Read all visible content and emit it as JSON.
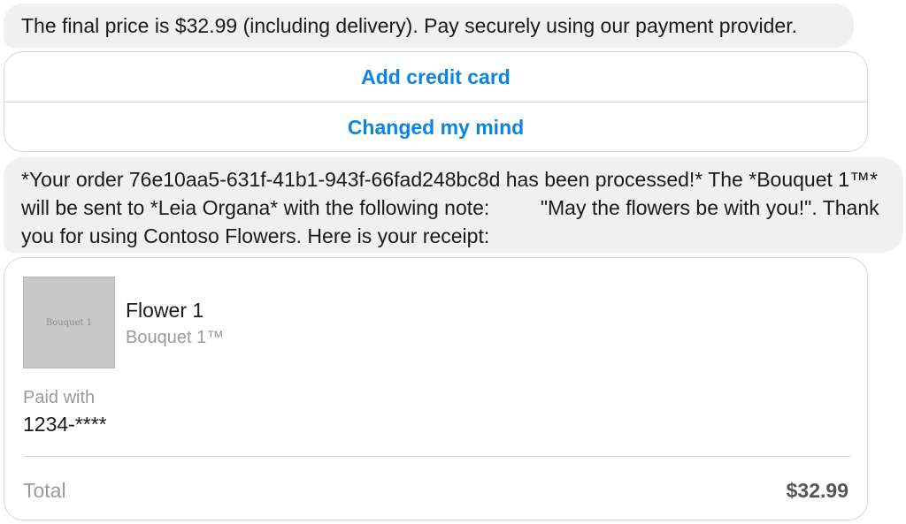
{
  "messages": {
    "price_message": "The final price is $32.99 (including delivery). Pay securely using our payment provider.",
    "order_message": "*Your order 76e10aa5-631f-41b1-943f-66fad248bc8d has been processed!* The *Bouquet 1™* will be sent to *Leia Organa* with the following note:         \"May the flowers be with you!\". Thank you for using Contoso Flowers. Here is your receipt:"
  },
  "actions": {
    "add_credit_card": "Add credit card",
    "changed_my_mind": "Changed my mind"
  },
  "receipt": {
    "item": {
      "image_alt": "Bouquet 1",
      "title": "Flower 1",
      "subtitle": "Bouquet 1™"
    },
    "paid_with_label": "Paid with",
    "paid_with_value": "1234-****",
    "total_label": "Total",
    "total_value": "$32.99"
  },
  "colors": {
    "accent": "#0a84e6",
    "bubble_bg": "#f0f0f0",
    "border": "#d6d6d6"
  }
}
